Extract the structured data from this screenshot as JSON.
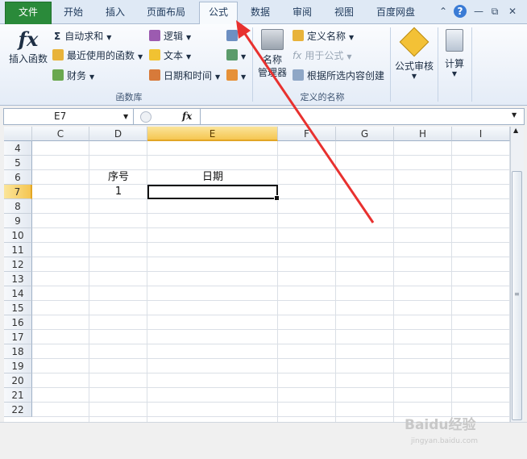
{
  "tabs": [
    {
      "label": "文件",
      "state": "file"
    },
    {
      "label": "开始",
      "state": "normal"
    },
    {
      "label": "插入",
      "state": "normal"
    },
    {
      "label": "页面布局",
      "state": "normal"
    },
    {
      "label": "公式",
      "state": "active"
    },
    {
      "label": "数据",
      "state": "normal"
    },
    {
      "label": "审阅",
      "state": "normal"
    },
    {
      "label": "视图",
      "state": "normal"
    },
    {
      "label": "百度网盘",
      "state": "normal"
    }
  ],
  "window_controls": {
    "collapse": "⌃",
    "help": "?",
    "minimize": "—",
    "restore": "⧉",
    "close": "✕"
  },
  "ribbon": {
    "insert_function": "插入函数",
    "autosum": "自动求和",
    "recent": "最近使用的函数",
    "finance": "财务",
    "logic": "逻辑",
    "text": "文本",
    "datetime": "日期和时间",
    "group_function_lib": "函数库",
    "name_manager_line1": "名称",
    "name_manager_line2": "管理器",
    "define_name": "定义名称",
    "use_in_formula": "用于公式",
    "create_from_selection": "根据所选内容创建",
    "group_defined_names": "定义的名称",
    "formula_audit": "公式审核",
    "calculate": "计算"
  },
  "formula_bar": {
    "name_box": "E7",
    "fx": "fx",
    "formula": ""
  },
  "sheet": {
    "columns": [
      "C",
      "D",
      "E",
      "F",
      "G",
      "H",
      "I"
    ],
    "selected_column": "E",
    "rows": [
      "4",
      "5",
      "6",
      "7",
      "8",
      "9",
      "10",
      "11",
      "12",
      "13",
      "14",
      "15",
      "16",
      "17",
      "18",
      "19",
      "20",
      "21",
      "22"
    ],
    "selected_row": "7",
    "cells": {
      "D6": "序号",
      "E6": "日期",
      "D7": "1"
    }
  },
  "watermark": {
    "brand": "Baidu经验",
    "url": "jingyan.baidu.com"
  },
  "colors": {
    "file_tab": "#2a8a3a",
    "arrow": "#e8312f",
    "selection_header": "#f5c652"
  }
}
